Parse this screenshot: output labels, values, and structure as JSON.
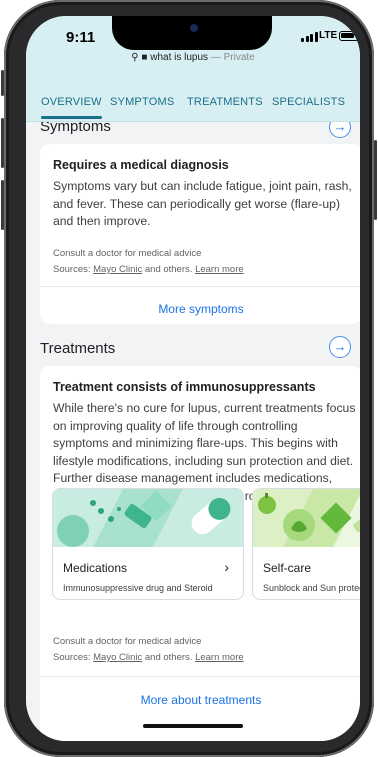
{
  "status_bar": {
    "time": "9:11",
    "network": "LTE"
  },
  "address_bar": {
    "query": "what is lupus",
    "mode": "— Private"
  },
  "tabs": [
    {
      "label": "OVERVIEW",
      "active": true
    },
    {
      "label": "SYMPTOMS",
      "active": false
    },
    {
      "label": "TREATMENTS",
      "active": false
    },
    {
      "label": "SPECIALISTS",
      "active": false
    }
  ],
  "symptoms": {
    "section_title": "Symptoms",
    "heading": "Requires a medical diagnosis",
    "body": "Symptoms vary but can include fatigue, joint pain, rash, and fever. These can periodically get worse (flare-up) and then improve.",
    "disclaimer": "Consult a doctor for medical advice",
    "sources_prefix": "Sources: ",
    "sources_link": "Mayo Clinic",
    "sources_mid": " and others. ",
    "learn_more": "Learn more",
    "more_link": "More symptoms"
  },
  "treatments": {
    "section_title": "Treatments",
    "heading": "Treatment consists of immunosuppressants",
    "body": "While there's no cure for lupus, current treatments focus on improving quality of life through controlling symptoms and minimizing flare-ups. This begins with lifestyle modifications, including sun protection and diet. Further disease management includes medications, such as anti-inflammatories and steroids.",
    "tiles": [
      {
        "title": "Medications",
        "subtitle": "Immunosuppressive drug and Steroid",
        "chevron": "›"
      },
      {
        "title": "Self-care",
        "subtitle": "Sunblock and Sun protection"
      }
    ],
    "disclaimer": "Consult a doctor for medical advice",
    "sources_prefix": "Sources: ",
    "sources_link": "Mayo Clinic",
    "sources_mid": " and others. ",
    "learn_more": "Learn more",
    "more_link": "More about treatments"
  },
  "icons": {
    "arrow": "→",
    "lock": "🔒",
    "search": "🔍"
  },
  "colors": {
    "header_bg": "#d7eff3",
    "tab_text": "#1a6f8a",
    "link": "#1a73e8",
    "page_bg": "#f1f3f4"
  }
}
